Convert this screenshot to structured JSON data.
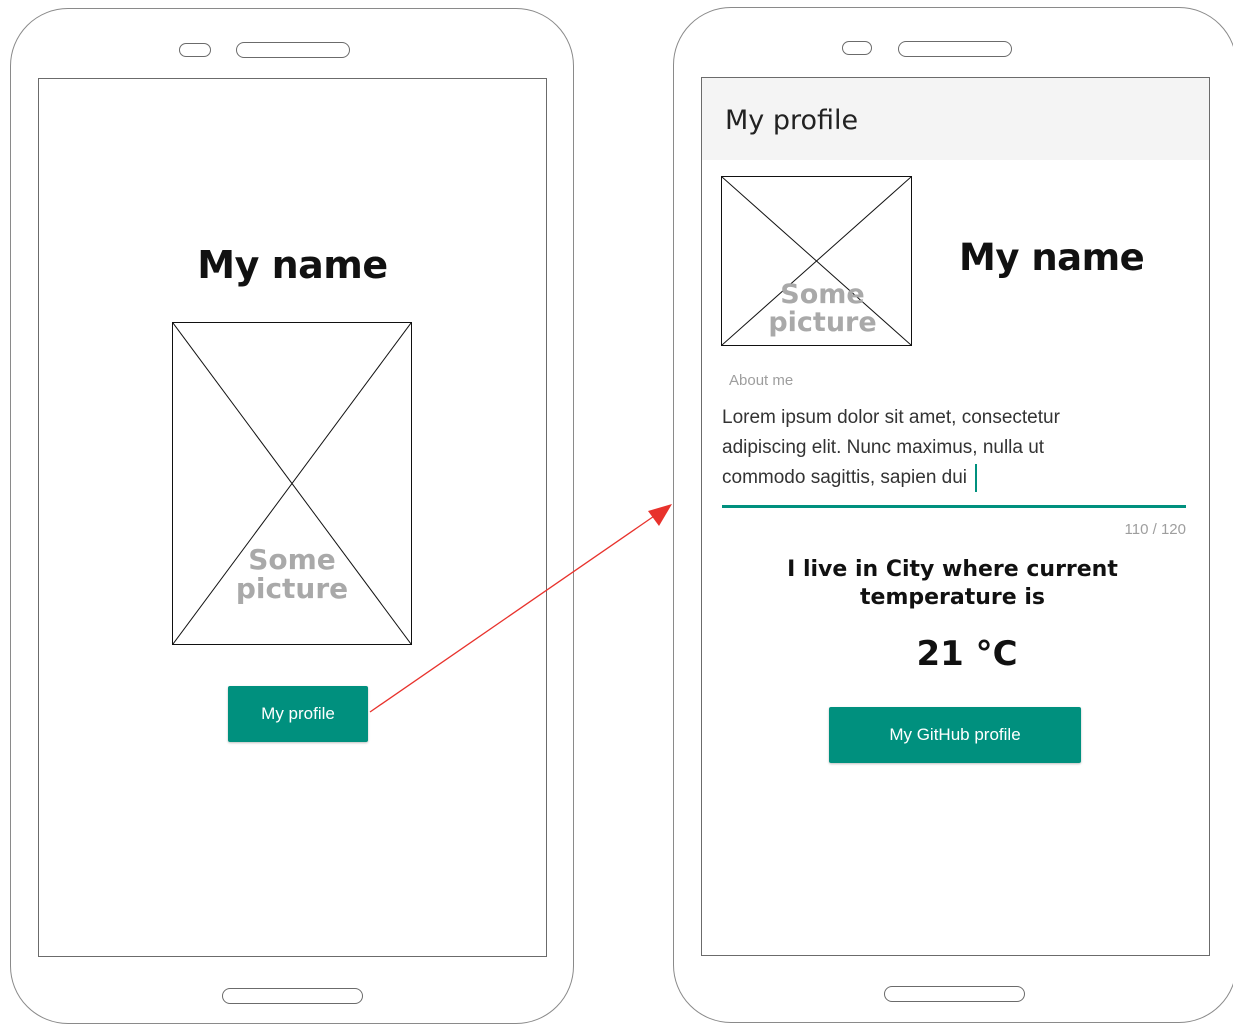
{
  "left_screen": {
    "name_heading": "My name",
    "picture_placeholder": {
      "line1": "Some",
      "line2": "picture"
    },
    "profile_button_label": "My profile"
  },
  "right_screen": {
    "appbar_title": "My profile",
    "picture_placeholder": {
      "line1": "Some",
      "line2": "picture"
    },
    "name_heading": "My name",
    "about_field": {
      "label": "About me",
      "value": "Lorem ipsum dolor sit amet, consectetur adipiscing elit. Nunc maximus, nulla ut commodo sagittis, sapien dui",
      "counter": "110 / 120"
    },
    "city_text": "I live in City where current temperature is",
    "temperature": "21 °C",
    "github_button_label": "My GitHub profile"
  },
  "colors": {
    "accent": "#00907e",
    "arrow": "#e8322c",
    "placeholder_text": "#a9a9a9"
  }
}
